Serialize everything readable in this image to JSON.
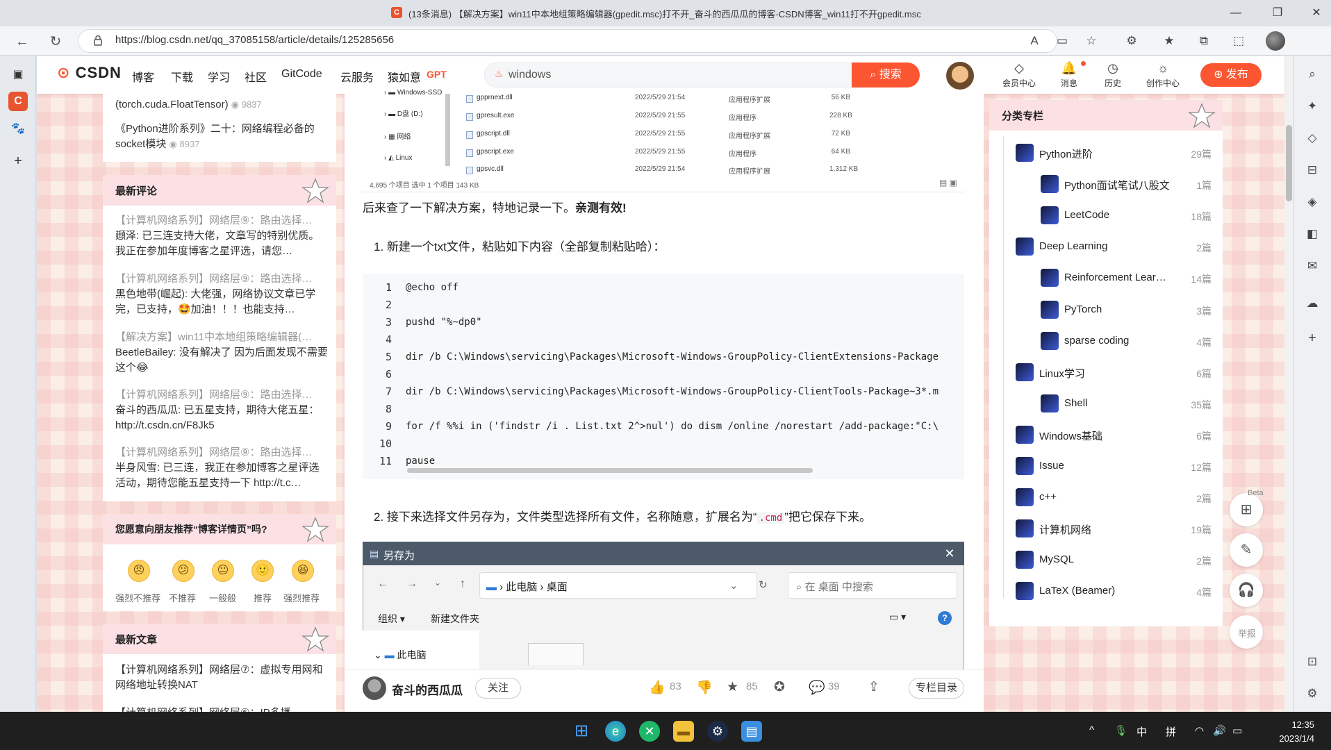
{
  "window": {
    "title": "(13条消息) 【解决方案】win11中本地组策略编辑器(gpedit.msc)打不开_奋斗的西瓜瓜的博客-CSDN博客_win11打不开gpedit.msc",
    "url": "https://blog.csdn.net/qq_37085158/article/details/125285656",
    "favicon_letter": "C"
  },
  "colors": {
    "accent": "#fc5531",
    "card_head": "#fbe0e4"
  },
  "csdn_nav": {
    "logo": "CSDN",
    "links": [
      "博客",
      "下载",
      "学习",
      "社区",
      "GitCode",
      "云服务",
      "猿如意"
    ],
    "gpt": "GPT",
    "search_value": "windows",
    "search_button": "搜索",
    "icons": [
      {
        "icon": "diamond-icon",
        "label": "会员中心"
      },
      {
        "icon": "bell-icon",
        "label": "消息"
      },
      {
        "icon": "clock-icon",
        "label": "历史"
      },
      {
        "icon": "bulb-icon",
        "label": "创作中心"
      }
    ],
    "publish": "发布"
  },
  "left": {
    "top_items": [
      {
        "text": "(torch.cuda.FloatTensor)",
        "views": "9837"
      },
      {
        "text": "《Python进阶系列》二十：网络编程必备的socket模块",
        "views": "8937"
      }
    ],
    "comments_title": "最新评论",
    "comments": [
      {
        "article": "【计算机网络系列】网络层⑨：路由选择…",
        "body": "頲泽: 已三连支持大佬，文章写的特别优质。我正在参加年度博客之星评选，请您…"
      },
      {
        "article": "【计算机网络系列】网络层⑨：路由选择…",
        "body": "黑色地带(崛起): 大佬强，网络协议文章已学完，已支持，🤩加油！！！也能支持…"
      },
      {
        "article": "【解决方案】win11中本地组策略编辑器(…",
        "body": "BeetleBailey: 没有解决了 因为后面发现不需要这个😂"
      },
      {
        "article": "【计算机网络系列】网络层⑨：路由选择…",
        "body": "奋斗的西瓜瓜: 已五星支持，期待大佬五星：http://t.csdn.cn/F8Jk5"
      },
      {
        "article": "【计算机网络系列】网络层⑨：路由选择…",
        "body": "半身风雪: 已三连，我正在参加博客之星评选活动，期待您能五星支持一下 http://t.c…"
      }
    ],
    "recommend_title": "您愿意向朋友推荐“博客详情页”吗?",
    "ratings": [
      {
        "face": "😠",
        "label": "强烈不推荐"
      },
      {
        "face": "😕",
        "label": "不推荐"
      },
      {
        "face": "😐",
        "label": "一般般"
      },
      {
        "face": "🙂",
        "label": "推荐"
      },
      {
        "face": "😆",
        "label": "强烈推荐"
      }
    ],
    "latest_title": "最新文章",
    "latest": [
      "【计算机网络系列】网络层⑦：虚拟专用网和网络地址转换NAT",
      "【计算机网络系列】网络层⑥：IP多播"
    ]
  },
  "explorer": {
    "tree": [
      "Windows-SSD",
      "D盘 (D:)",
      "网络",
      "Linux"
    ],
    "files": [
      {
        "name": "gpprnext.dll",
        "date": "2022/5/29 21:54",
        "type": "应用程序扩展",
        "size": "56 KB"
      },
      {
        "name": "gpresult.exe",
        "date": "2022/5/29 21:55",
        "type": "应用程序",
        "size": "228 KB"
      },
      {
        "name": "gpscript.dll",
        "date": "2022/5/29 21:55",
        "type": "应用程序扩展",
        "size": "72 KB"
      },
      {
        "name": "gpscript.exe",
        "date": "2022/5/29 21:55",
        "type": "应用程序",
        "size": "64 KB"
      },
      {
        "name": "gpsvc.dll",
        "date": "2022/5/29 21:54",
        "type": "应用程序扩展",
        "size": "1,312 KB"
      }
    ],
    "status": "4,695 个项目    选中 1 个项目  143 KB"
  },
  "article": {
    "p1": "后来查了一下解决方案，特地记录一下。",
    "p1_bold": "亲测有效!",
    "step1": "1. 新建一个txt文件，粘贴如下内容（全部复制粘贴哈）：",
    "code_lines": [
      "@echo off",
      "",
      "pushd \"%~dp0\"",
      "",
      "dir /b C:\\Windows\\servicing\\Packages\\Microsoft-Windows-GroupPolicy-ClientExtensions-Package",
      "",
      "dir /b C:\\Windows\\servicing\\Packages\\Microsoft-Windows-GroupPolicy-ClientTools-Package~3*.m",
      "",
      "for /f %%i in ('findstr /i . List.txt 2^>nul') do dism /online /norestart /add-package:\"C:\\",
      "",
      "pause"
    ],
    "step2_a": "2. 接下来选择文件另存为，文件类型选择所有文件，名称随意，扩展名为“",
    "step2_code": ".cmd",
    "step2_b": "”把它保存下来。"
  },
  "dialog": {
    "title": "另存为",
    "path": [
      "此电脑",
      "桌面"
    ],
    "search_placeholder": "在 桌面 中搜索",
    "organize": "组织",
    "new_folder": "新建文件夹",
    "tree_item": "此电脑"
  },
  "actionbar": {
    "author": "奋斗的西瓜瓜",
    "follow": "关注",
    "likes": "83",
    "favorites": "85",
    "comments": "39",
    "toc": "专栏目录"
  },
  "right": {
    "title": "分类专栏",
    "columns": [
      {
        "name": "Python进阶",
        "count": "29篇",
        "level": 0
      },
      {
        "name": "Python面试笔试八股文",
        "count": "1篇",
        "level": 1
      },
      {
        "name": "LeetCode",
        "count": "18篇",
        "level": 1
      },
      {
        "name": "Deep Learning",
        "count": "2篇",
        "level": 0
      },
      {
        "name": "Reinforcement Lear…",
        "count": "14篇",
        "level": 1
      },
      {
        "name": "PyTorch",
        "count": "3篇",
        "level": 1
      },
      {
        "name": "sparse coding",
        "count": "4篇",
        "level": 1
      },
      {
        "name": "Linux学习",
        "count": "6篇",
        "level": 0
      },
      {
        "name": "Shell",
        "count": "35篇",
        "level": 1
      },
      {
        "name": "Windows基础",
        "count": "6篇",
        "level": 0
      },
      {
        "name": "Issue",
        "count": "12篇",
        "level": 0
      },
      {
        "name": "c++",
        "count": "2篇",
        "level": 0
      },
      {
        "name": "计算机网络",
        "count": "19篇",
        "level": 0
      },
      {
        "name": "MySQL",
        "count": "2篇",
        "level": 0
      },
      {
        "name": "LaTeX (Beamer)",
        "count": "4篇",
        "level": 0
      }
    ],
    "beta": "Beta",
    "report": "举报"
  },
  "taskbar": {
    "ime1": "中",
    "ime2": "拼",
    "time": "12:35",
    "date": "2023/1/4"
  }
}
